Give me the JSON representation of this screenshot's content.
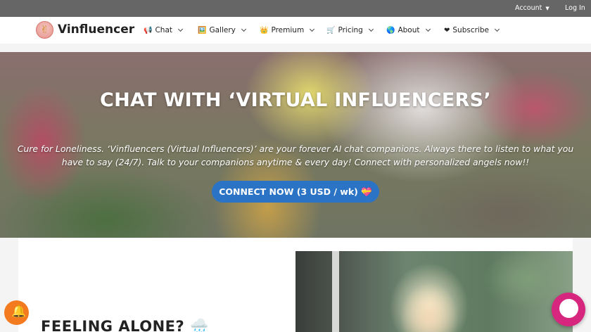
{
  "topbar": {
    "account": "Account",
    "login": "Log In"
  },
  "navbar": {
    "brand": "Vinfluencer",
    "items": [
      {
        "icon": "📢",
        "label": "Chat"
      },
      {
        "icon": "🖼️",
        "label": "Gallery"
      },
      {
        "icon": "👑",
        "label": "Premium"
      },
      {
        "icon": "🛒",
        "label": "Pricing"
      },
      {
        "icon": "🌎",
        "label": "About"
      },
      {
        "icon": "❤",
        "label": "Subscribe"
      }
    ]
  },
  "hero": {
    "title": "CHAT WITH ‘VIRTUAL INFLUENCERS’",
    "text": "Cure for Loneliness. ‘Vinfluencers (Virtual Influencers)’ are your forever AI chat companions. Always there to listen to what you have to say (24/7). Talk to your companions anytime & every day! Connect with personalized angels now!!",
    "cta": "CONNECT NOW (3 USD / wk) 💝"
  },
  "section": {
    "title": "FEELING ALONE? 🌧️"
  },
  "icons": {
    "logo": "peace-hand-icon",
    "notification": "bell-icon",
    "chat": "chat-bubble-icon"
  },
  "colors": {
    "cta": "#2b73c4",
    "bell": "#f47a20",
    "chat": "#d6267e",
    "topbar": "#666666"
  }
}
